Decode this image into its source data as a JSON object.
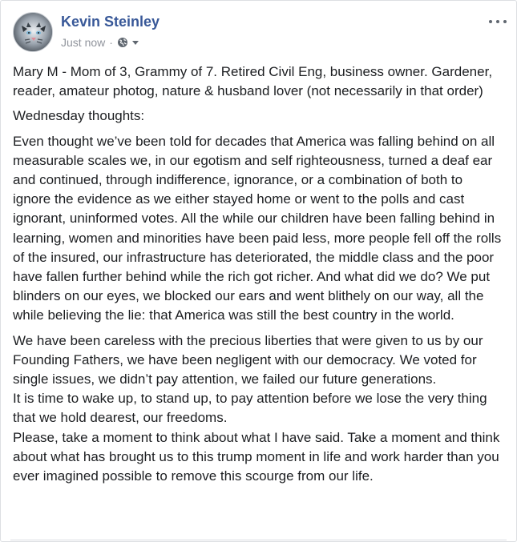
{
  "post": {
    "author": "Kevin Steinley",
    "timestamp": "Just now",
    "separator": "·",
    "privacy_icon": "globe-icon",
    "paragraphs": [
      "Mary M - Mom of 3, Grammy of 7. Retired Civil Eng, business owner. Gardener, reader, amateur photog, nature & husband lover (not necessarily in that order)",
      "Wednesday thoughts:",
      "Even thought we’ve been told for decades that America was falling behind on all measurable scales we, in our egotism and self righteousness, turned a deaf ear and continued, through indifference, ignorance, or a combination of both to ignore the evidence as we either stayed home or went to the polls and cast ignorant, uninformed votes. All the while our children have been falling behind in learning, women and minorities have been paid less, more people fell off the rolls of the insured, our infrastructure has deteriorated, the middle class and the poor have fallen further behind while the rich got richer. And what did we do? We put blinders on our eyes, we blocked our ears and went blithely on our way, all the while believing the lie: that America was still the best country in the world."
    ],
    "final_lines": [
      "We have been careless with the precious liberties that were given to us by our Founding Fathers, we have been negligent with our democracy. We voted for single issues, we didn’t pay attention, we failed our future generations.",
      "It is time to wake up, to stand up, to pay attention before we lose the very thing that we hold dearest, our freedoms.",
      "Please, take a moment to think about what I have said. Take a moment and think about what has brought us to this trump moment in life and work harder than you ever imagined possible to remove this scourge from our life."
    ]
  },
  "colors": {
    "author_link": "#385898",
    "meta_text": "#90949c",
    "body_text": "#1c1e21"
  }
}
